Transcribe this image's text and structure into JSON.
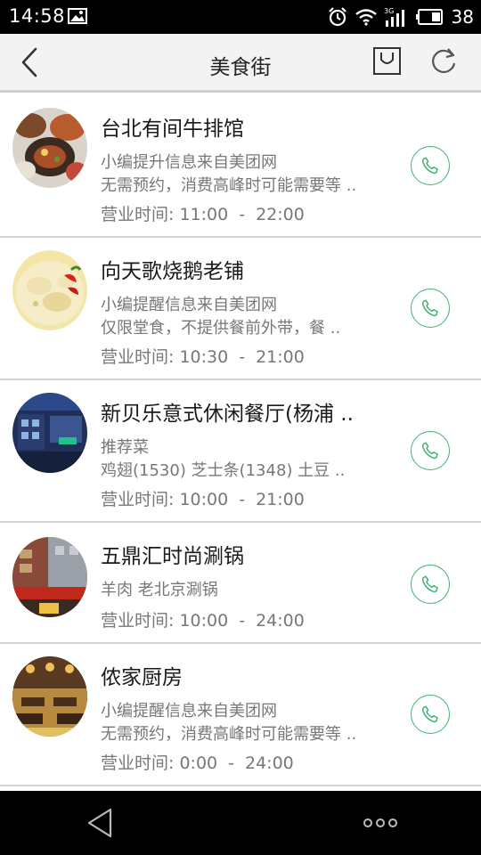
{
  "status_bar": {
    "time": "14:58",
    "network": "3G",
    "battery": "38",
    "icons": [
      "image-icon",
      "alarm-icon",
      "wifi-icon",
      "signal-icon",
      "battery-icon"
    ]
  },
  "header": {
    "title": "美食街",
    "icons": [
      "back-arrow-icon",
      "bag-icon",
      "refresh-icon"
    ]
  },
  "colors": {
    "accent_green": "#3cb371",
    "divider": "#d4d4d4",
    "header_bg": "#f3f3f3"
  },
  "restaurants": [
    {
      "name": "台北有间牛排馆",
      "line1": "小编提升信息来自美团网",
      "line2": "无需预约，消费高峰时可能需要等 ..",
      "hours_label": "营业时间:",
      "open": "11:00",
      "dash": "-",
      "close": "22:00"
    },
    {
      "name": "向天歌烧鹅老铺",
      "line1": "小编提醒信息来自美团网",
      "line2": "仅限堂食，不提供餐前外带，餐 ..",
      "hours_label": "营业时间:",
      "open": "10:30",
      "dash": "-",
      "close": "21:00"
    },
    {
      "name": "新贝乐意式休闲餐厅(杨浦 ..",
      "line1": "推荐菜",
      "line2": "鸡翅(1530) 芝士条(1348) 土豆 ..",
      "hours_label": "营业时间:",
      "open": "10:00",
      "dash": "-",
      "close": "21:00"
    },
    {
      "name": "五鼎汇时尚涮锅",
      "line1": "羊肉 老北京涮锅",
      "line2": "",
      "hours_label": "营业时间:",
      "open": "10:00",
      "dash": "-",
      "close": "24:00"
    },
    {
      "name": "侬家厨房",
      "line1": "小编提醒信息来自美团网",
      "line2": "无需预约，消费高峰时可能需要等 ..",
      "hours_label": "营业时间:",
      "open": "0:00",
      "dash": "-",
      "close": "24:00"
    }
  ],
  "nav_bar": {
    "icons": [
      "back-triangle-icon",
      "more-dots-icon"
    ]
  }
}
